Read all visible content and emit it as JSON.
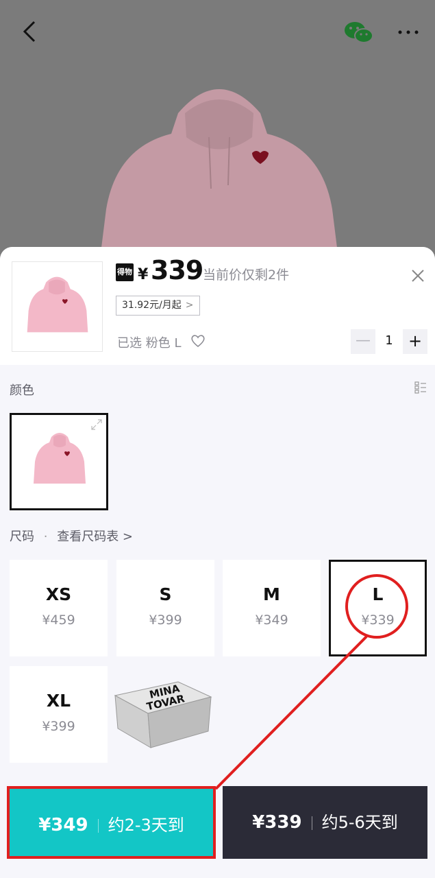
{
  "header": {
    "back_icon": "chevron-left-icon",
    "share_icon": "wechat-icon",
    "more_icon": "more-dots-icon",
    "more_label": "···"
  },
  "product": {
    "badge": "得物",
    "currency": "¥",
    "price": "339",
    "stock_note": "当前价仅剩2件",
    "installment": "31.92元/月起",
    "installment_chevron": ">",
    "selected_label": "已选 粉色 L",
    "quantity": "1",
    "minus_label": "—",
    "plus_label": "+"
  },
  "color_section": {
    "label": "颜色",
    "selected_color": "粉色"
  },
  "size_section": {
    "label": "尺码",
    "dot": "·",
    "chart_link": "查看尺码表 >",
    "sizes": [
      {
        "name": "XS",
        "price": "¥459"
      },
      {
        "name": "S",
        "price": "¥399"
      },
      {
        "name": "M",
        "price": "¥349"
      },
      {
        "name": "L",
        "price": "¥339"
      },
      {
        "name": "XL",
        "price": "¥399"
      }
    ],
    "selected_size": "L"
  },
  "watermark": {
    "line1": "MINA",
    "line2": "TOVAR"
  },
  "actions": {
    "fast": {
      "price": "¥349",
      "delivery": "约2-3天到"
    },
    "normal": {
      "price": "¥339",
      "delivery": "约5-6天到"
    }
  },
  "colors": {
    "accent_teal": "#13c6c6",
    "dark_button": "#2b2b37",
    "annotation_red": "#e01f1f",
    "hoodie_pink": "#f3b8c8"
  }
}
